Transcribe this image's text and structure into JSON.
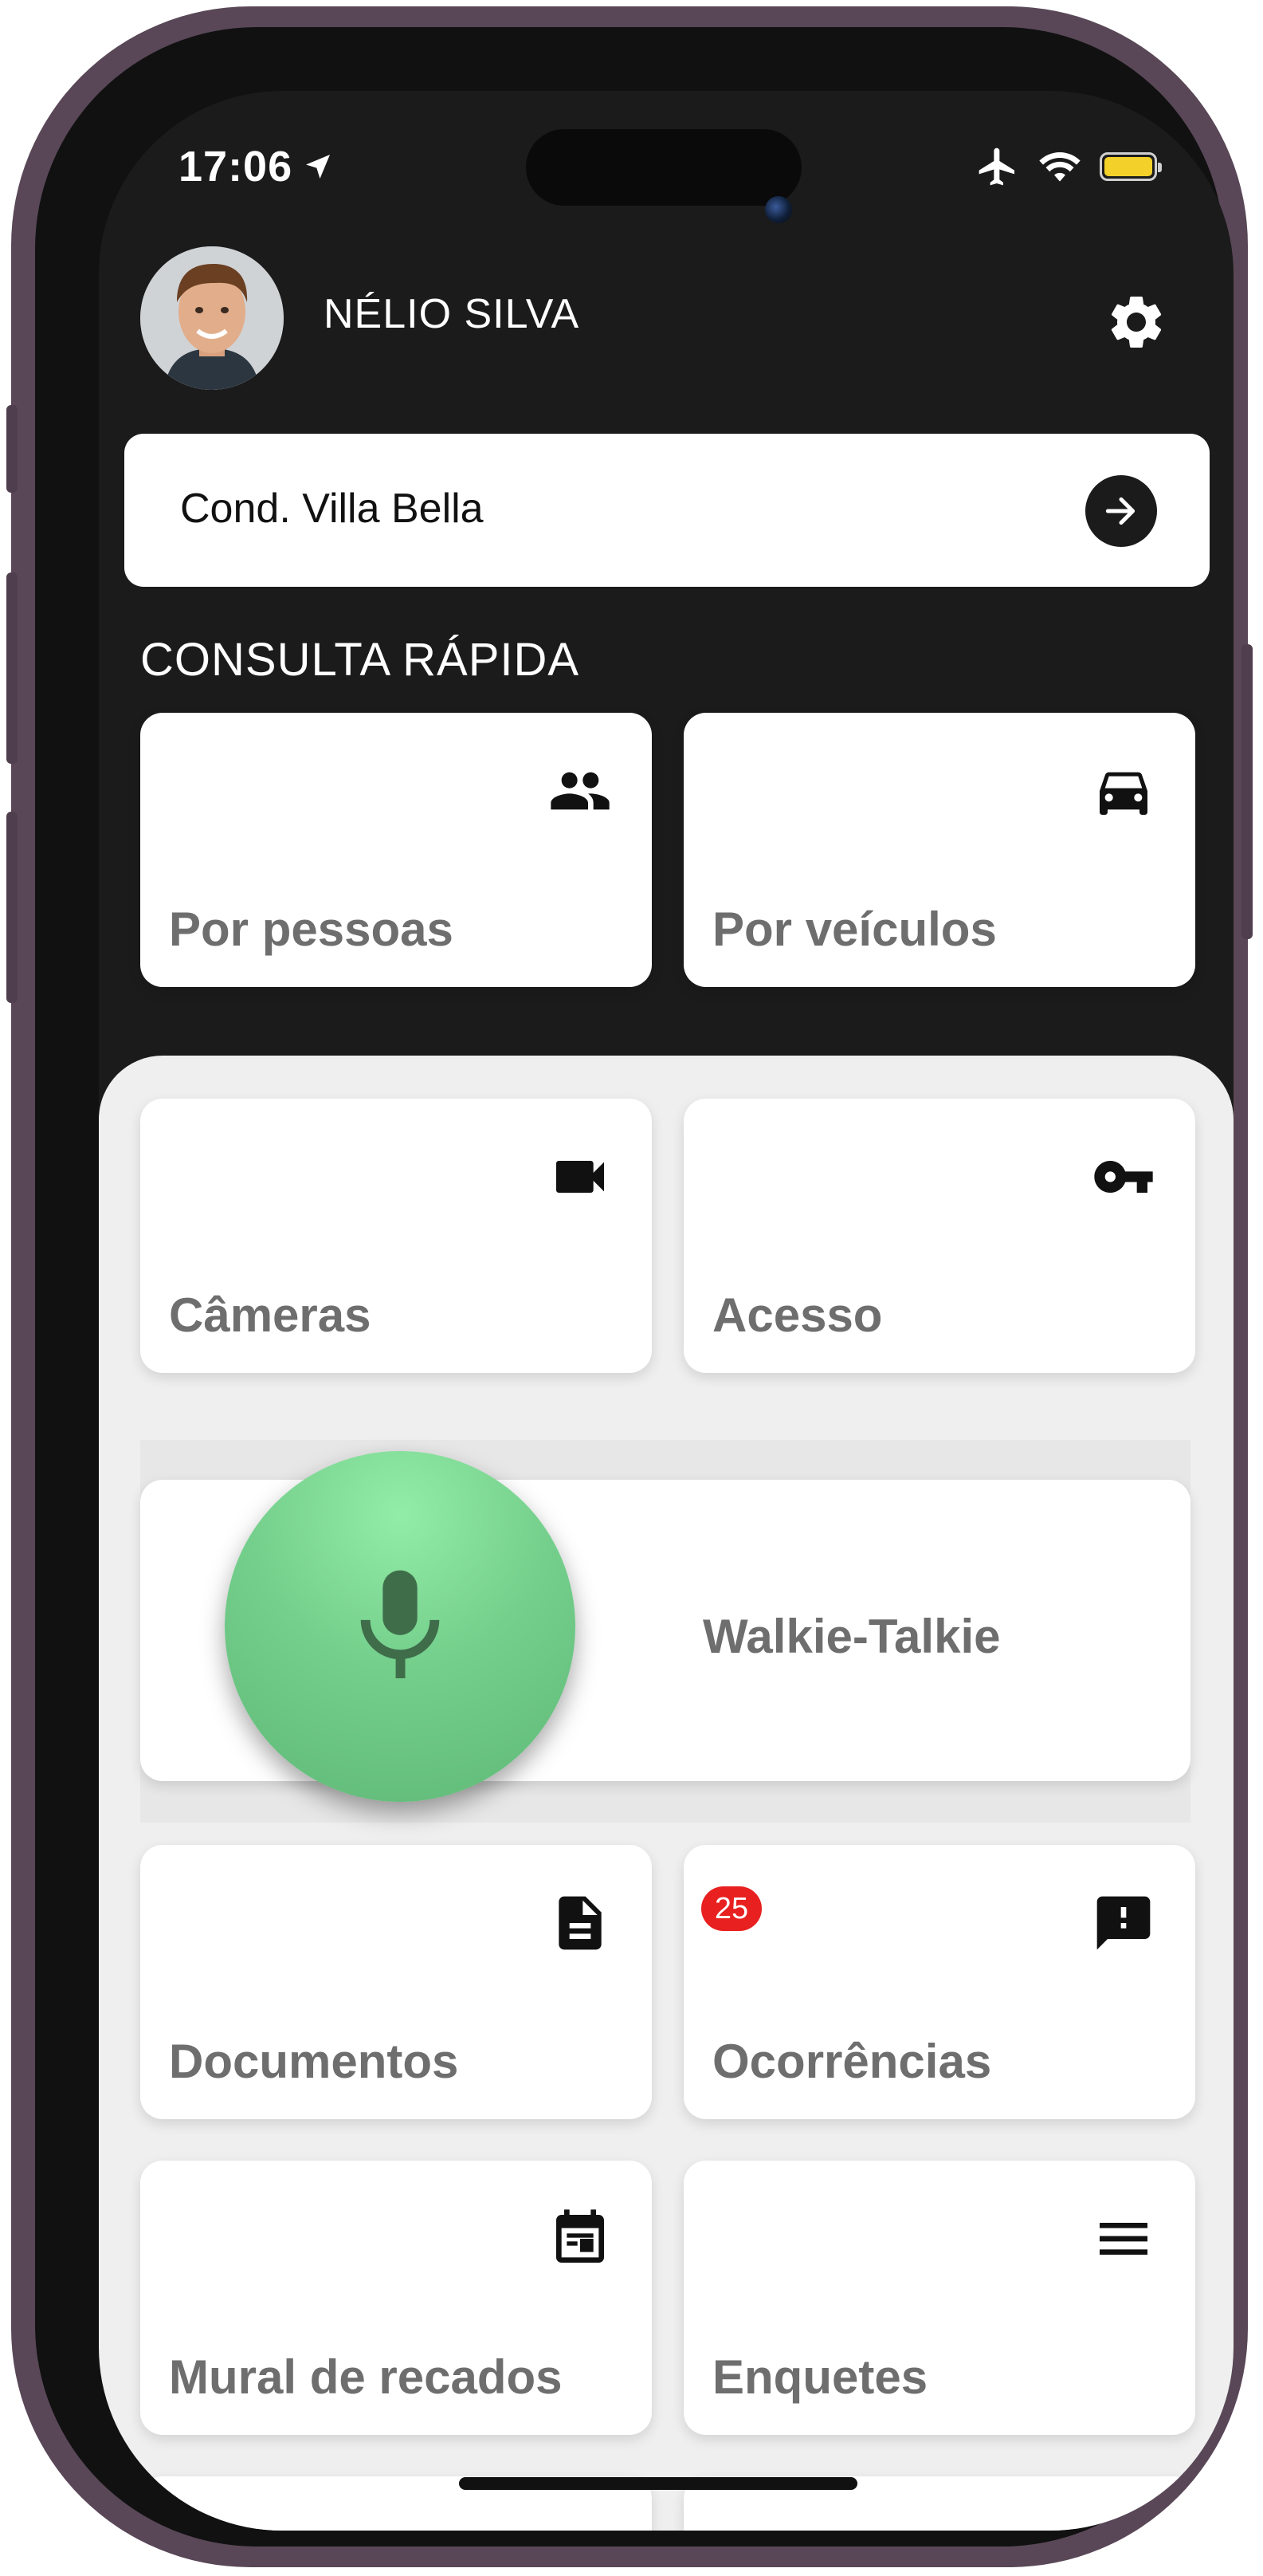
{
  "status_bar": {
    "time": "17:06"
  },
  "header": {
    "user_name": "NÉLIO SILVA"
  },
  "condo": {
    "name": "Cond. Villa Bella"
  },
  "quick_search": {
    "title": "CONSULTA RÁPIDA",
    "items": [
      {
        "label": "Por pessoas",
        "icon": "people-icon"
      },
      {
        "label": "Por veículos",
        "icon": "car-icon"
      }
    ]
  },
  "menu": {
    "cameras": {
      "label": "Câmeras",
      "icon": "videocam-icon"
    },
    "access": {
      "label": "Acesso",
      "icon": "key-icon"
    },
    "walkie_talkie": {
      "label": "Walkie-Talkie",
      "icon": "mic-icon"
    },
    "documents": {
      "label": "Documentos",
      "icon": "document-icon"
    },
    "occurrences": {
      "label": "Ocorrências",
      "icon": "feedback-icon",
      "badge": "25"
    },
    "message_board": {
      "label": "Mural de recados",
      "icon": "calendar-icon"
    },
    "polls": {
      "label": "Enquetes",
      "icon": "menu-icon"
    }
  },
  "colors": {
    "background": "#1b1b1b",
    "panel": "#efefef",
    "mic_button": "#75cf8c",
    "badge": "#e82020",
    "label_text": "#6e6e6e"
  }
}
